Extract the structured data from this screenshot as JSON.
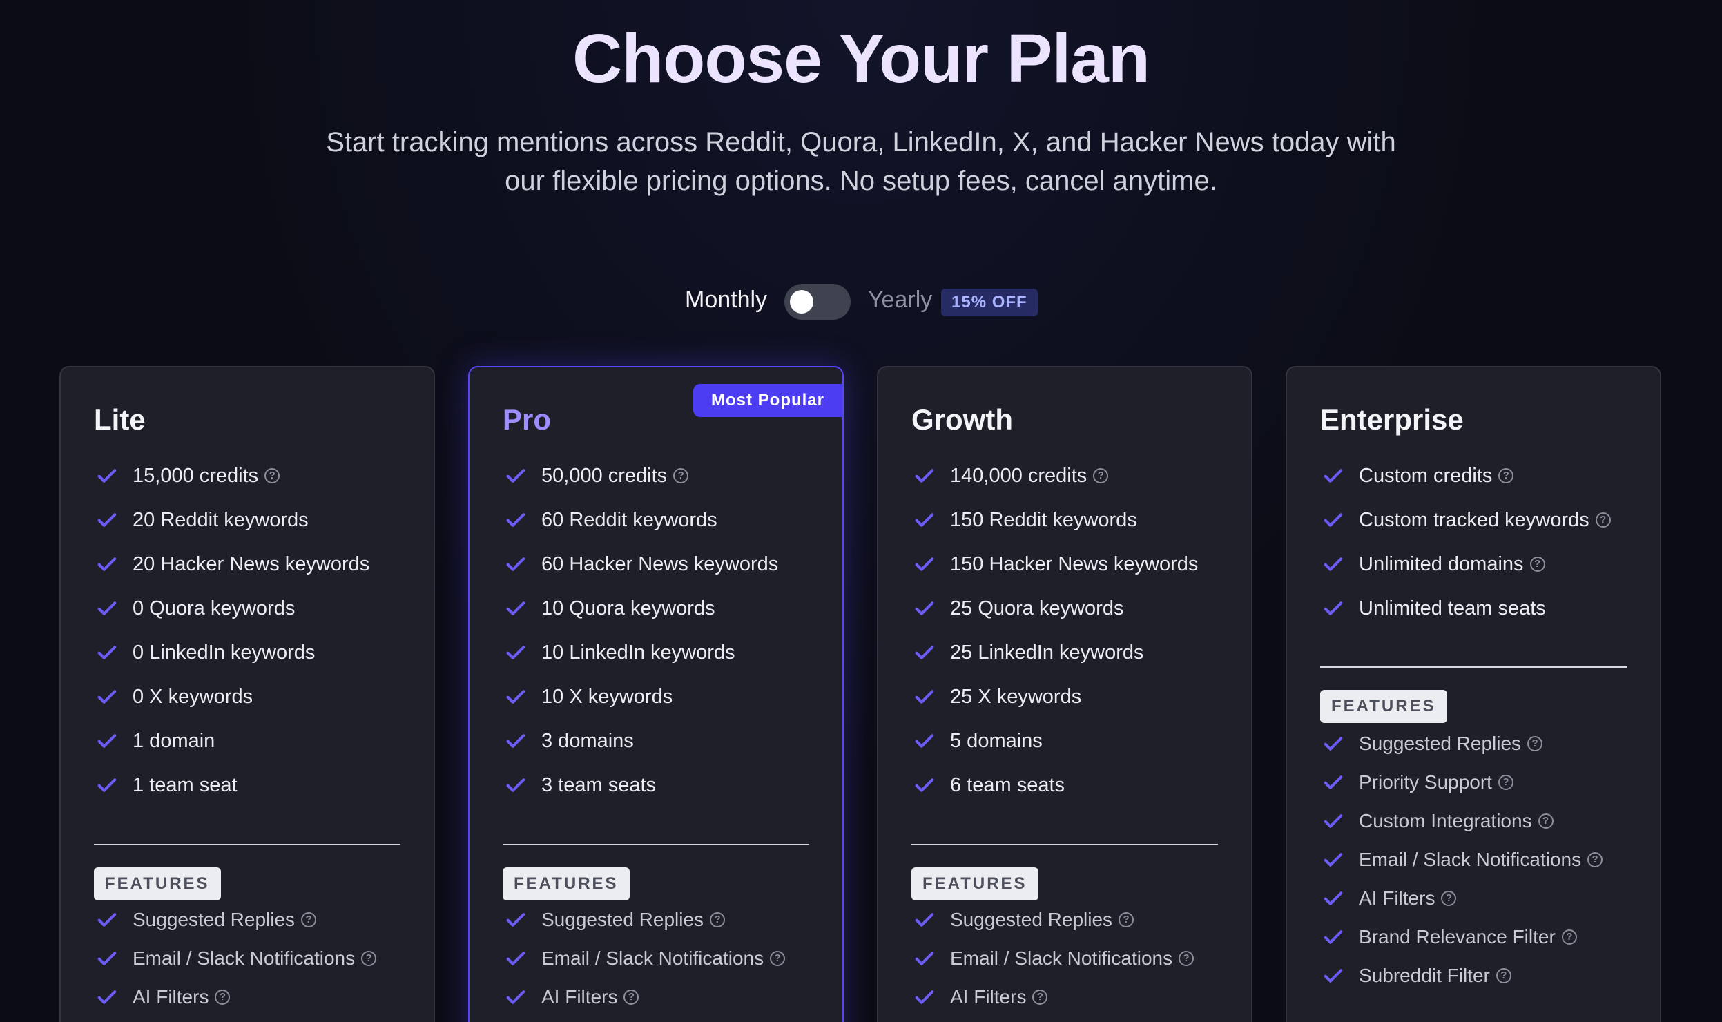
{
  "hero": {
    "title": "Choose Your Plan",
    "subtitle_line1": "Start tracking mentions across Reddit, Quora, LinkedIn, X, and Hacker News today with",
    "subtitle_line2": "our flexible pricing options. No setup fees, cancel anytime."
  },
  "billing": {
    "monthly_label": "Monthly",
    "yearly_label": "Yearly",
    "discount_badge": "15% OFF",
    "toggle_on": false
  },
  "colors": {
    "accent": "#4c3df2",
    "check": "#6c5cf5",
    "pro_title": "#9d8dff",
    "background": "#0b0c15",
    "card": "#1e1f28"
  },
  "icons": {
    "check": "check-icon",
    "help": "help-circle-icon",
    "help_glyph": "?"
  },
  "features_label": "FEATURES",
  "plans": [
    {
      "name": "Lite",
      "items": [
        {
          "text": "15,000 credits",
          "help": true
        },
        {
          "text": "20 Reddit keywords",
          "help": false
        },
        {
          "text": "20 Hacker News keywords",
          "help": false
        },
        {
          "text": "0 Quora keywords",
          "help": false
        },
        {
          "text": "0 LinkedIn keywords",
          "help": false
        },
        {
          "text": "0 X keywords",
          "help": false
        },
        {
          "text": "1 domain",
          "help": false
        },
        {
          "text": "1 team seat",
          "help": false
        }
      ],
      "features": [
        {
          "text": "Suggested Replies",
          "help": true
        },
        {
          "text": "Email / Slack Notifications",
          "help": true
        },
        {
          "text": "AI Filters",
          "help": true
        }
      ]
    },
    {
      "name": "Pro",
      "badge": "Most Popular",
      "items": [
        {
          "text": "50,000 credits",
          "help": true
        },
        {
          "text": "60 Reddit keywords",
          "help": false
        },
        {
          "text": "60 Hacker News keywords",
          "help": false
        },
        {
          "text": "10 Quora keywords",
          "help": false
        },
        {
          "text": "10 LinkedIn keywords",
          "help": false
        },
        {
          "text": "10 X keywords",
          "help": false
        },
        {
          "text": "3 domains",
          "help": false
        },
        {
          "text": "3 team seats",
          "help": false
        }
      ],
      "features": [
        {
          "text": "Suggested Replies",
          "help": true
        },
        {
          "text": "Email / Slack Notifications",
          "help": true
        },
        {
          "text": "AI Filters",
          "help": true
        }
      ]
    },
    {
      "name": "Growth",
      "items": [
        {
          "text": "140,000 credits",
          "help": true
        },
        {
          "text": "150 Reddit keywords",
          "help": false
        },
        {
          "text": "150 Hacker News keywords",
          "help": false
        },
        {
          "text": "25 Quora keywords",
          "help": false
        },
        {
          "text": "25 LinkedIn keywords",
          "help": false
        },
        {
          "text": "25 X keywords",
          "help": false
        },
        {
          "text": "5 domains",
          "help": false
        },
        {
          "text": "6 team seats",
          "help": false
        }
      ],
      "features": [
        {
          "text": "Suggested Replies",
          "help": true
        },
        {
          "text": "Email / Slack Notifications",
          "help": true
        },
        {
          "text": "AI Filters",
          "help": true
        }
      ]
    },
    {
      "name": "Enterprise",
      "items": [
        {
          "text": "Custom credits",
          "help": true
        },
        {
          "text": "Custom tracked keywords",
          "help": true
        },
        {
          "text": "Unlimited domains",
          "help": true
        },
        {
          "text": "Unlimited team seats",
          "help": false
        }
      ],
      "features": [
        {
          "text": "Suggested Replies",
          "help": true
        },
        {
          "text": "Priority Support",
          "help": true
        },
        {
          "text": "Custom Integrations",
          "help": true
        },
        {
          "text": "Email / Slack Notifications",
          "help": true
        },
        {
          "text": "AI Filters",
          "help": true
        },
        {
          "text": "Brand Relevance Filter",
          "help": true
        },
        {
          "text": "Subreddit Filter",
          "help": true
        }
      ]
    }
  ]
}
